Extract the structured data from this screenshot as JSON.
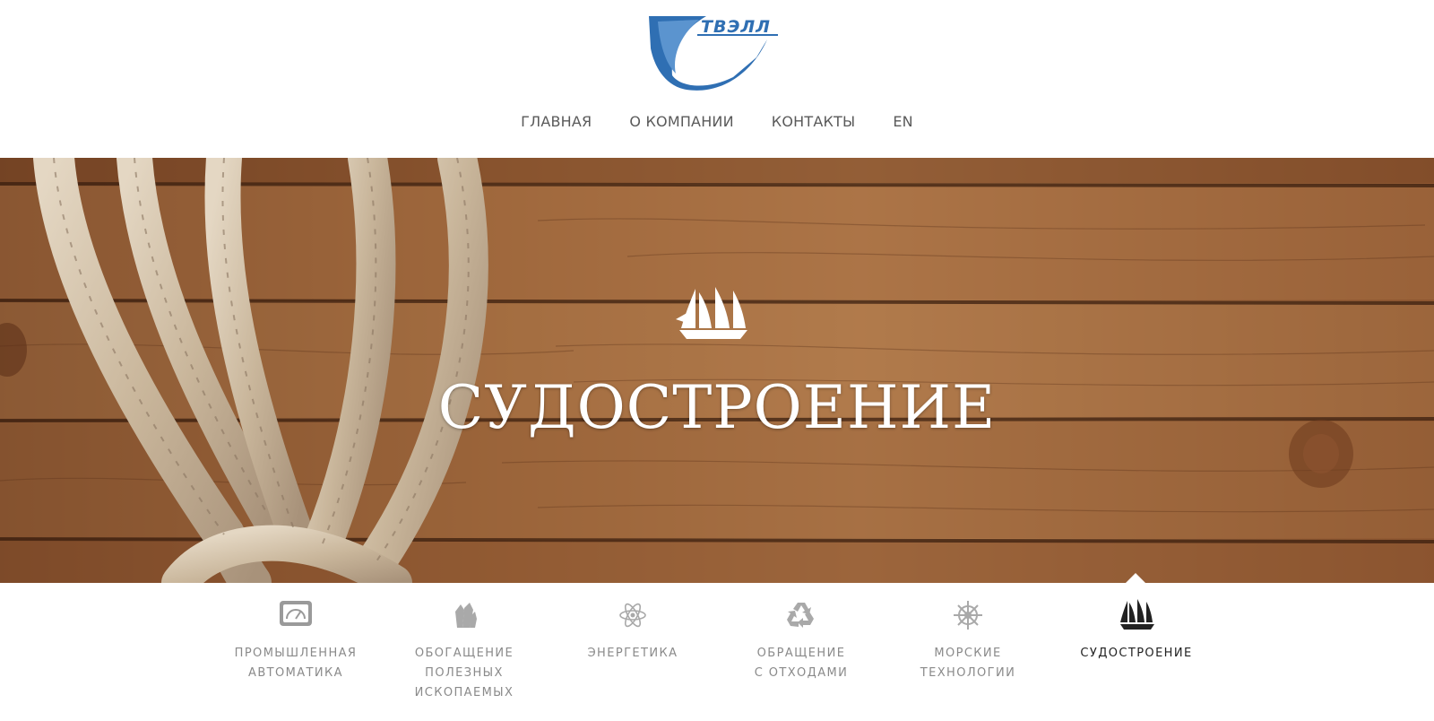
{
  "brand": {
    "logo_text": "ТВЭЛЛ",
    "brand_color": "#1b5fa6"
  },
  "nav": {
    "items": [
      {
        "label": "ГЛАВНАЯ"
      },
      {
        "label": "О КОМПАНИИ"
      },
      {
        "label": "КОНТАКТЫ"
      },
      {
        "label": "EN"
      }
    ]
  },
  "hero": {
    "title": "СУДОСТРОЕНИЕ",
    "icon": "sailing-ship-icon"
  },
  "categories": {
    "active_index": 5,
    "items": [
      {
        "label": "ПРОМЫШЛЕННАЯ\nАВТОМАТИКА",
        "icon": "gauge-icon"
      },
      {
        "label": "ОБОГАЩЕНИЕ\nПОЛЕЗНЫХ\nИСКОПАЕМЫХ",
        "icon": "crystal-icon"
      },
      {
        "label": "ЭНЕРГЕТИКА",
        "icon": "atom-icon"
      },
      {
        "label": "ОБРАЩЕНИЕ\nС ОТХОДАМИ",
        "icon": "recycle-icon"
      },
      {
        "label": "МОРСКИЕ\nТЕХНОЛОГИИ",
        "icon": "ship-wheel-icon"
      },
      {
        "label": "СУДОСТРОЕНИЕ",
        "icon": "sailing-ship-icon"
      }
    ]
  }
}
